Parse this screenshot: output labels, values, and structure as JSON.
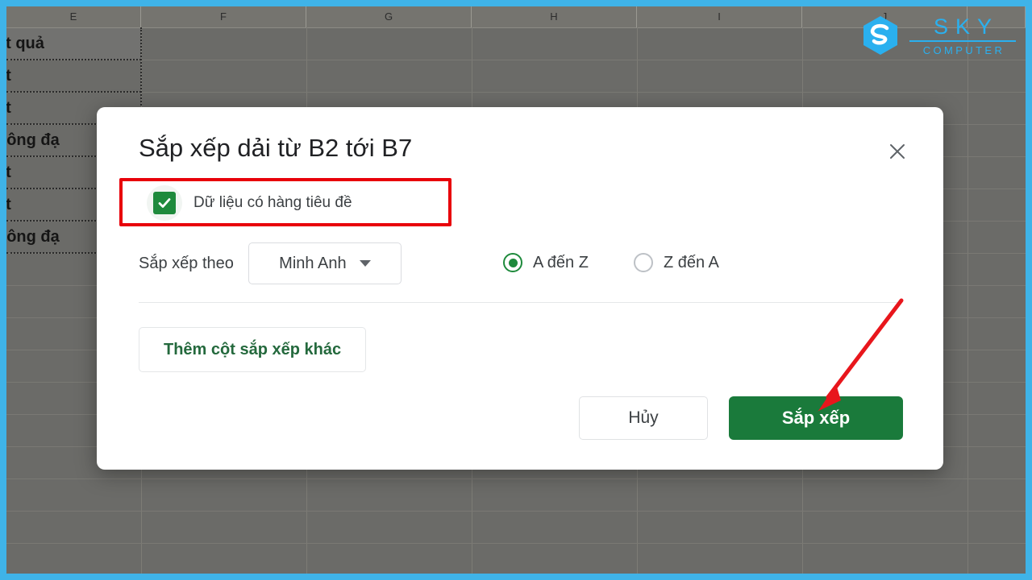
{
  "logo": {
    "brand": "SKY",
    "sub": "COMPUTER",
    "icon": "sky-hex-s-logo",
    "color": "#2ab0ef"
  },
  "spreadsheet": {
    "column_headers": [
      "E",
      "F",
      "G",
      "H",
      "I",
      "J"
    ],
    "visible_cells": [
      {
        "text": "ết quả",
        "is_header": true
      },
      {
        "text": "ạt",
        "is_header": false
      },
      {
        "text": "ạt",
        "is_header": false
      },
      {
        "text": "hông đạ",
        "is_header": false
      },
      {
        "text": "ạt",
        "is_header": false
      },
      {
        "text": "ạt",
        "is_header": false
      },
      {
        "text": "hông đạ",
        "is_header": false
      }
    ],
    "backdrop_color": "#6b6b68",
    "frame_color": "#3fb3e8"
  },
  "dialog": {
    "title": "Sắp xếp dải từ B2 tới B7",
    "close_label": "×",
    "header_checkbox": {
      "label": "Dữ liệu có hàng tiêu đề",
      "checked": true,
      "check_color": "#1e8a3c"
    },
    "sort_by": {
      "label": "Sắp xếp theo",
      "selected": "Minh Anh"
    },
    "order_options": [
      {
        "label": "A đến Z",
        "selected": true
      },
      {
        "label": "Z đến A",
        "selected": false
      }
    ],
    "add_column_label": "Thêm cột sắp xếp khác",
    "cancel_label": "Hủy",
    "sort_label": "Sắp xếp",
    "sort_button_color": "#1a7a3b"
  },
  "annotations": {
    "highlight_color": "#e8000a",
    "arrow_color": "#e8161c",
    "highlight_target": "header-checkbox-row",
    "arrow_target": "sort-button"
  }
}
